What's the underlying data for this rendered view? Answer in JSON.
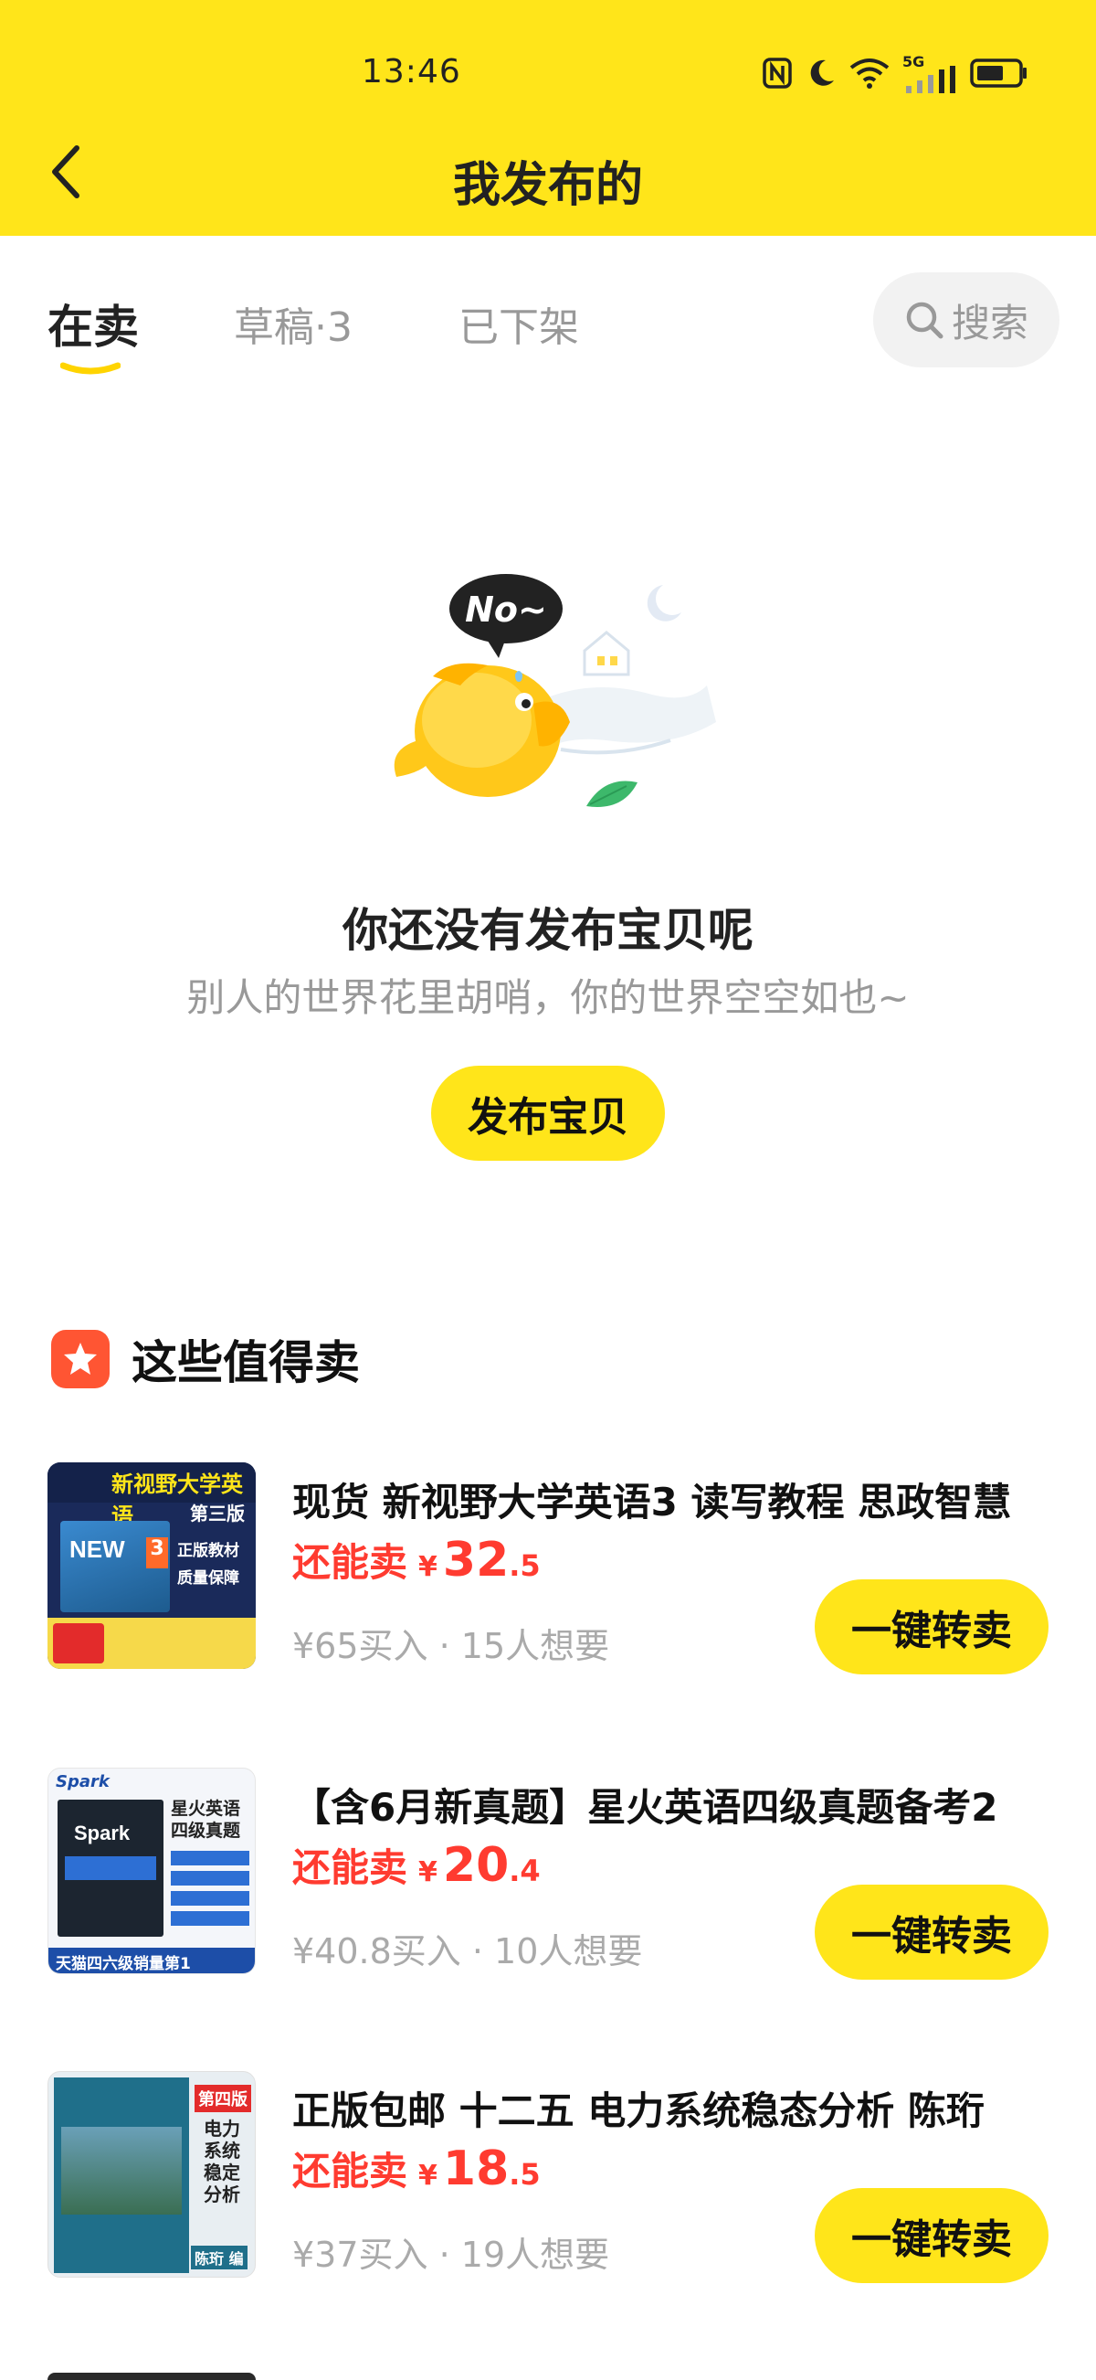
{
  "status_bar": {
    "time": "13:46",
    "network": "5G"
  },
  "header": {
    "title": "我发布的"
  },
  "tabs": [
    {
      "label": "在卖",
      "active": true
    },
    {
      "label": "草稿·3",
      "active": false
    },
    {
      "label": "已下架",
      "active": false
    }
  ],
  "search": {
    "label": "搜索"
  },
  "empty_state": {
    "bubble_text": "No~",
    "title": "你还没有发布宝贝呢",
    "subtitle": "别人的世界花里胡哨，你的世界空空如也~",
    "publish_button": "发布宝贝"
  },
  "section": {
    "title": "这些值得卖"
  },
  "products": [
    {
      "title": "现货 新视野大学英语3 读写教程 思政智慧",
      "price_label": "还能卖",
      "currency": "¥",
      "price_int": "32",
      "price_dec": ".5",
      "meta": "¥65买入 · 15人想要",
      "button": "一键转卖",
      "thumb_top": "新视野大学英语",
      "thumb_edition": "第三版",
      "thumb_badge1": "正版教材",
      "thumb_badge2": "质量保障"
    },
    {
      "title": "【含6月新真题】星火英语四级真题备考2",
      "price_label": "还能卖",
      "currency": "¥",
      "price_int": "20",
      "price_dec": ".4",
      "meta": "¥40.8买入 · 10人想要",
      "button": "一键转卖",
      "thumb_brand": "Spark",
      "thumb_title": "星火英语\n四级真题",
      "thumb_bottom": "天猫四六级销量第1"
    },
    {
      "title": "正版包邮 十二五 电力系统稳态分析 陈珩",
      "price_label": "还能卖",
      "currency": "¥",
      "price_int": "18",
      "price_dec": ".5",
      "meta": "¥37买入 · 19人想要",
      "button": "一键转卖",
      "thumb_edition": "第四版",
      "thumb_title": "电力系统稳定分析",
      "thumb_author": "陈珩 编"
    }
  ],
  "colors": {
    "brand_yellow": "#FFE51A",
    "price_red": "#FF3B30",
    "section_icon": "#FF5533"
  }
}
